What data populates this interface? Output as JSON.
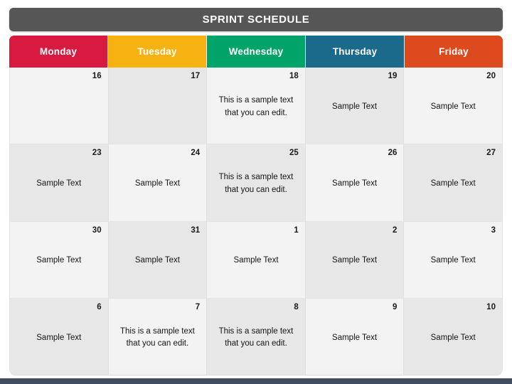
{
  "header": {
    "title": "SPRINT SCHEDULE",
    "title_bar_color": "#565656"
  },
  "days": [
    {
      "label": "Monday",
      "color": "#D81A41"
    },
    {
      "label": "Tuesday",
      "color": "#F5B210"
    },
    {
      "label": "Wednesday",
      "color": "#00A368"
    },
    {
      "label": "Thursday",
      "color": "#1B6A8C"
    },
    {
      "label": "Friday",
      "color": "#DC4A1E"
    }
  ],
  "sample_long_text": "This is a sample text that you can edit.",
  "sample_short_text": "Sample Text",
  "weeks": [
    {
      "cells": [
        {
          "date": "16",
          "text": "",
          "shade": "light"
        },
        {
          "date": "17",
          "text": "",
          "shade": "dark"
        },
        {
          "date": "18",
          "text": "This is a sample text that you can edit.",
          "shade": "light"
        },
        {
          "date": "19",
          "text": "Sample Text",
          "shade": "dark"
        },
        {
          "date": "20",
          "text": "Sample Text",
          "shade": "light"
        }
      ]
    },
    {
      "cells": [
        {
          "date": "23",
          "text": "Sample Text",
          "shade": "dark"
        },
        {
          "date": "24",
          "text": "Sample Text",
          "shade": "light"
        },
        {
          "date": "25",
          "text": "This is a sample text that you can edit.",
          "shade": "dark"
        },
        {
          "date": "26",
          "text": "Sample Text",
          "shade": "light"
        },
        {
          "date": "27",
          "text": "Sample Text",
          "shade": "dark"
        }
      ]
    },
    {
      "cells": [
        {
          "date": "30",
          "text": "Sample Text",
          "shade": "light"
        },
        {
          "date": "31",
          "text": "Sample Text",
          "shade": "dark"
        },
        {
          "date": "1",
          "text": "Sample Text",
          "shade": "light"
        },
        {
          "date": "2",
          "text": "Sample Text",
          "shade": "dark"
        },
        {
          "date": "3",
          "text": "Sample Text",
          "shade": "light"
        }
      ]
    },
    {
      "cells": [
        {
          "date": "6",
          "text": "Sample Text",
          "shade": "dark"
        },
        {
          "date": "7",
          "text": "This is a sample text that you can edit.",
          "shade": "light"
        },
        {
          "date": "8",
          "text": "This is a sample text that you can edit.",
          "shade": "dark"
        },
        {
          "date": "9",
          "text": "Sample Text",
          "shade": "light"
        },
        {
          "date": "10",
          "text": "Sample Text",
          "shade": "dark"
        }
      ]
    }
  ],
  "footer": {
    "strip_color": "#414d5e"
  }
}
